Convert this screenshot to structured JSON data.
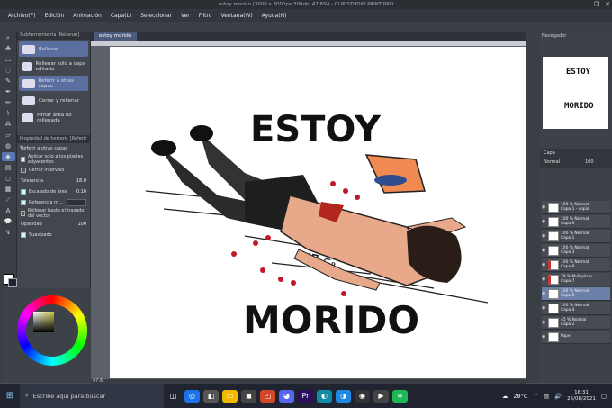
{
  "window": {
    "title": "estoy morido (3000 x 3000px 300dpi 47.6%)  - CLIP STUDIO PAINT PRO",
    "controls": [
      "—",
      "❐",
      "✕"
    ]
  },
  "menu": [
    "Archivo(F)",
    "Edición",
    "Animación",
    "Capa(L)",
    "Seleccionar",
    "Ver",
    "Filtro",
    "Ventana(W)",
    "Ayuda(H)"
  ],
  "subtool": {
    "tab_labels": [
      "Subherramienta [Rellenar]",
      "Rellena"
    ],
    "items": [
      {
        "label": "Rellenar",
        "selected": true
      },
      {
        "label": "Rellenar solo a capa editada",
        "selected": false
      },
      {
        "label": "Referir a otras capas",
        "selected": true
      },
      {
        "label": "Cerrar y rellenar",
        "selected": false
      },
      {
        "label": "Pintar área no rellenada",
        "selected": false
      }
    ]
  },
  "properties": {
    "header": "Propiedad de herram. [Referir a ...",
    "section": "Referir a otras capas",
    "rows": [
      {
        "label": "Aplicar solo a los píxeles adyacentes",
        "checked": true
      },
      {
        "label": "Cerrar intervalo",
        "checked": false
      },
      {
        "label": "Tolerancia",
        "value": "18.0"
      },
      {
        "label": "Escalado de área",
        "value": "0.10"
      },
      {
        "label": "Referencia m...",
        "value": ""
      },
      {
        "label": "Rellenar hasta el trazado del vector",
        "checked": false
      },
      {
        "label": "Opacidad",
        "value": "100"
      },
      {
        "label": "Suavizado",
        "checked": true
      }
    ]
  },
  "document": {
    "tab": "estoy morido",
    "zoom": "47.6"
  },
  "artwork": {
    "top_text": "ESTOY",
    "bottom_text": "MORIDO",
    "tattoo": "ꟽ∏ₒ⊂ₒ"
  },
  "navigator": {
    "label": "Navegador",
    "zoom": "47.6",
    "top_text": "ESTOY",
    "bottom_text": "MORIDO"
  },
  "layers": {
    "tabs": [
      "Capa"
    ],
    "blend": "Normal",
    "opacity": "100",
    "items": [
      {
        "line1": "100 % Normal",
        "line2": "Capa 1 - copia",
        "selected": false,
        "red": false
      },
      {
        "line1": "100 % Normal",
        "line2": "Capa 6",
        "selected": false,
        "red": false
      },
      {
        "line1": "100 % Normal",
        "line2": "Capa 1",
        "selected": false,
        "red": false
      },
      {
        "line1": "100 % Normal",
        "line2": "Capa 3",
        "selected": false,
        "red": false
      },
      {
        "line1": "100 % Normal",
        "line2": "Capa 8",
        "selected": false,
        "red": true
      },
      {
        "line1": "79 % Multiplicar",
        "line2": "Capa 7",
        "selected": false,
        "red": true
      },
      {
        "line1": "100 % Normal",
        "line2": "Capa 5",
        "selected": true,
        "red": false
      },
      {
        "line1": "100 % Normal",
        "line2": "Capa 4",
        "selected": false,
        "red": false
      },
      {
        "line1": "45 % Normal",
        "line2": "Capa 2",
        "selected": false,
        "red": false
      },
      {
        "line1": "",
        "line2": "Papel",
        "selected": false,
        "red": false
      }
    ]
  },
  "taskbar": {
    "search_placeholder": "Escribe aquí para buscar",
    "weather": "28°C",
    "time": "16:31",
    "date": "25/08/2021"
  }
}
